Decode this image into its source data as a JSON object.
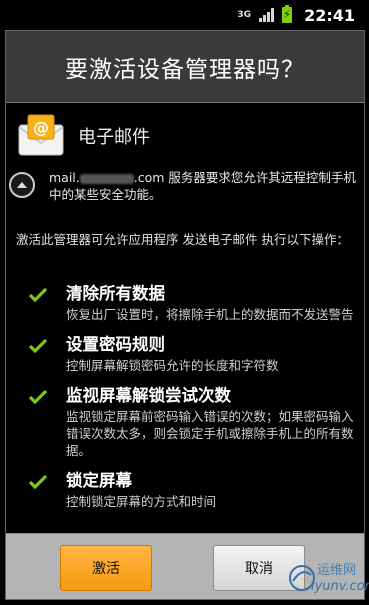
{
  "statusbar": {
    "network": "3G",
    "time": "22:41"
  },
  "dialog": {
    "title": "要激活设备管理器吗？",
    "app_name": "电子邮件",
    "server_prefix": "mail.",
    "server_suffix": ".com 服务器要求您允许其远程控制手机中的某些安全功能。",
    "intro": "激活此管理器可允许应用程序 发送电子邮件 执行以下操作：",
    "permissions": [
      {
        "title": "清除所有数据",
        "desc": "恢复出厂设置时，将擦除手机上的数据而不发送警告"
      },
      {
        "title": "设置密码规则",
        "desc": "控制屏幕解锁密码允许的长度和字符数"
      },
      {
        "title": "监视屏幕解锁尝试次数",
        "desc": "监视锁定屏幕前密码输入错误的次数；如果密码输入错误次数太多，则会锁定手机或擦除手机上的所有数据。"
      },
      {
        "title": "锁定屏幕",
        "desc": "控制锁定屏幕的方式和时间"
      }
    ],
    "activate_label": "激活",
    "cancel_label": "取消"
  },
  "watermark": {
    "line1": "运维网",
    "line2": "iyunv.com"
  },
  "colors": {
    "accent_orange": "#f79a12",
    "check_green": "#7ec61c",
    "titlebar_bg": "#3a3a3a",
    "buttonbar_bg": "#b4b4b4"
  },
  "icons": {
    "app": "mail-envelope-icon",
    "expand": "collapse-arrow-icon",
    "permission": "checkmark-icon"
  }
}
